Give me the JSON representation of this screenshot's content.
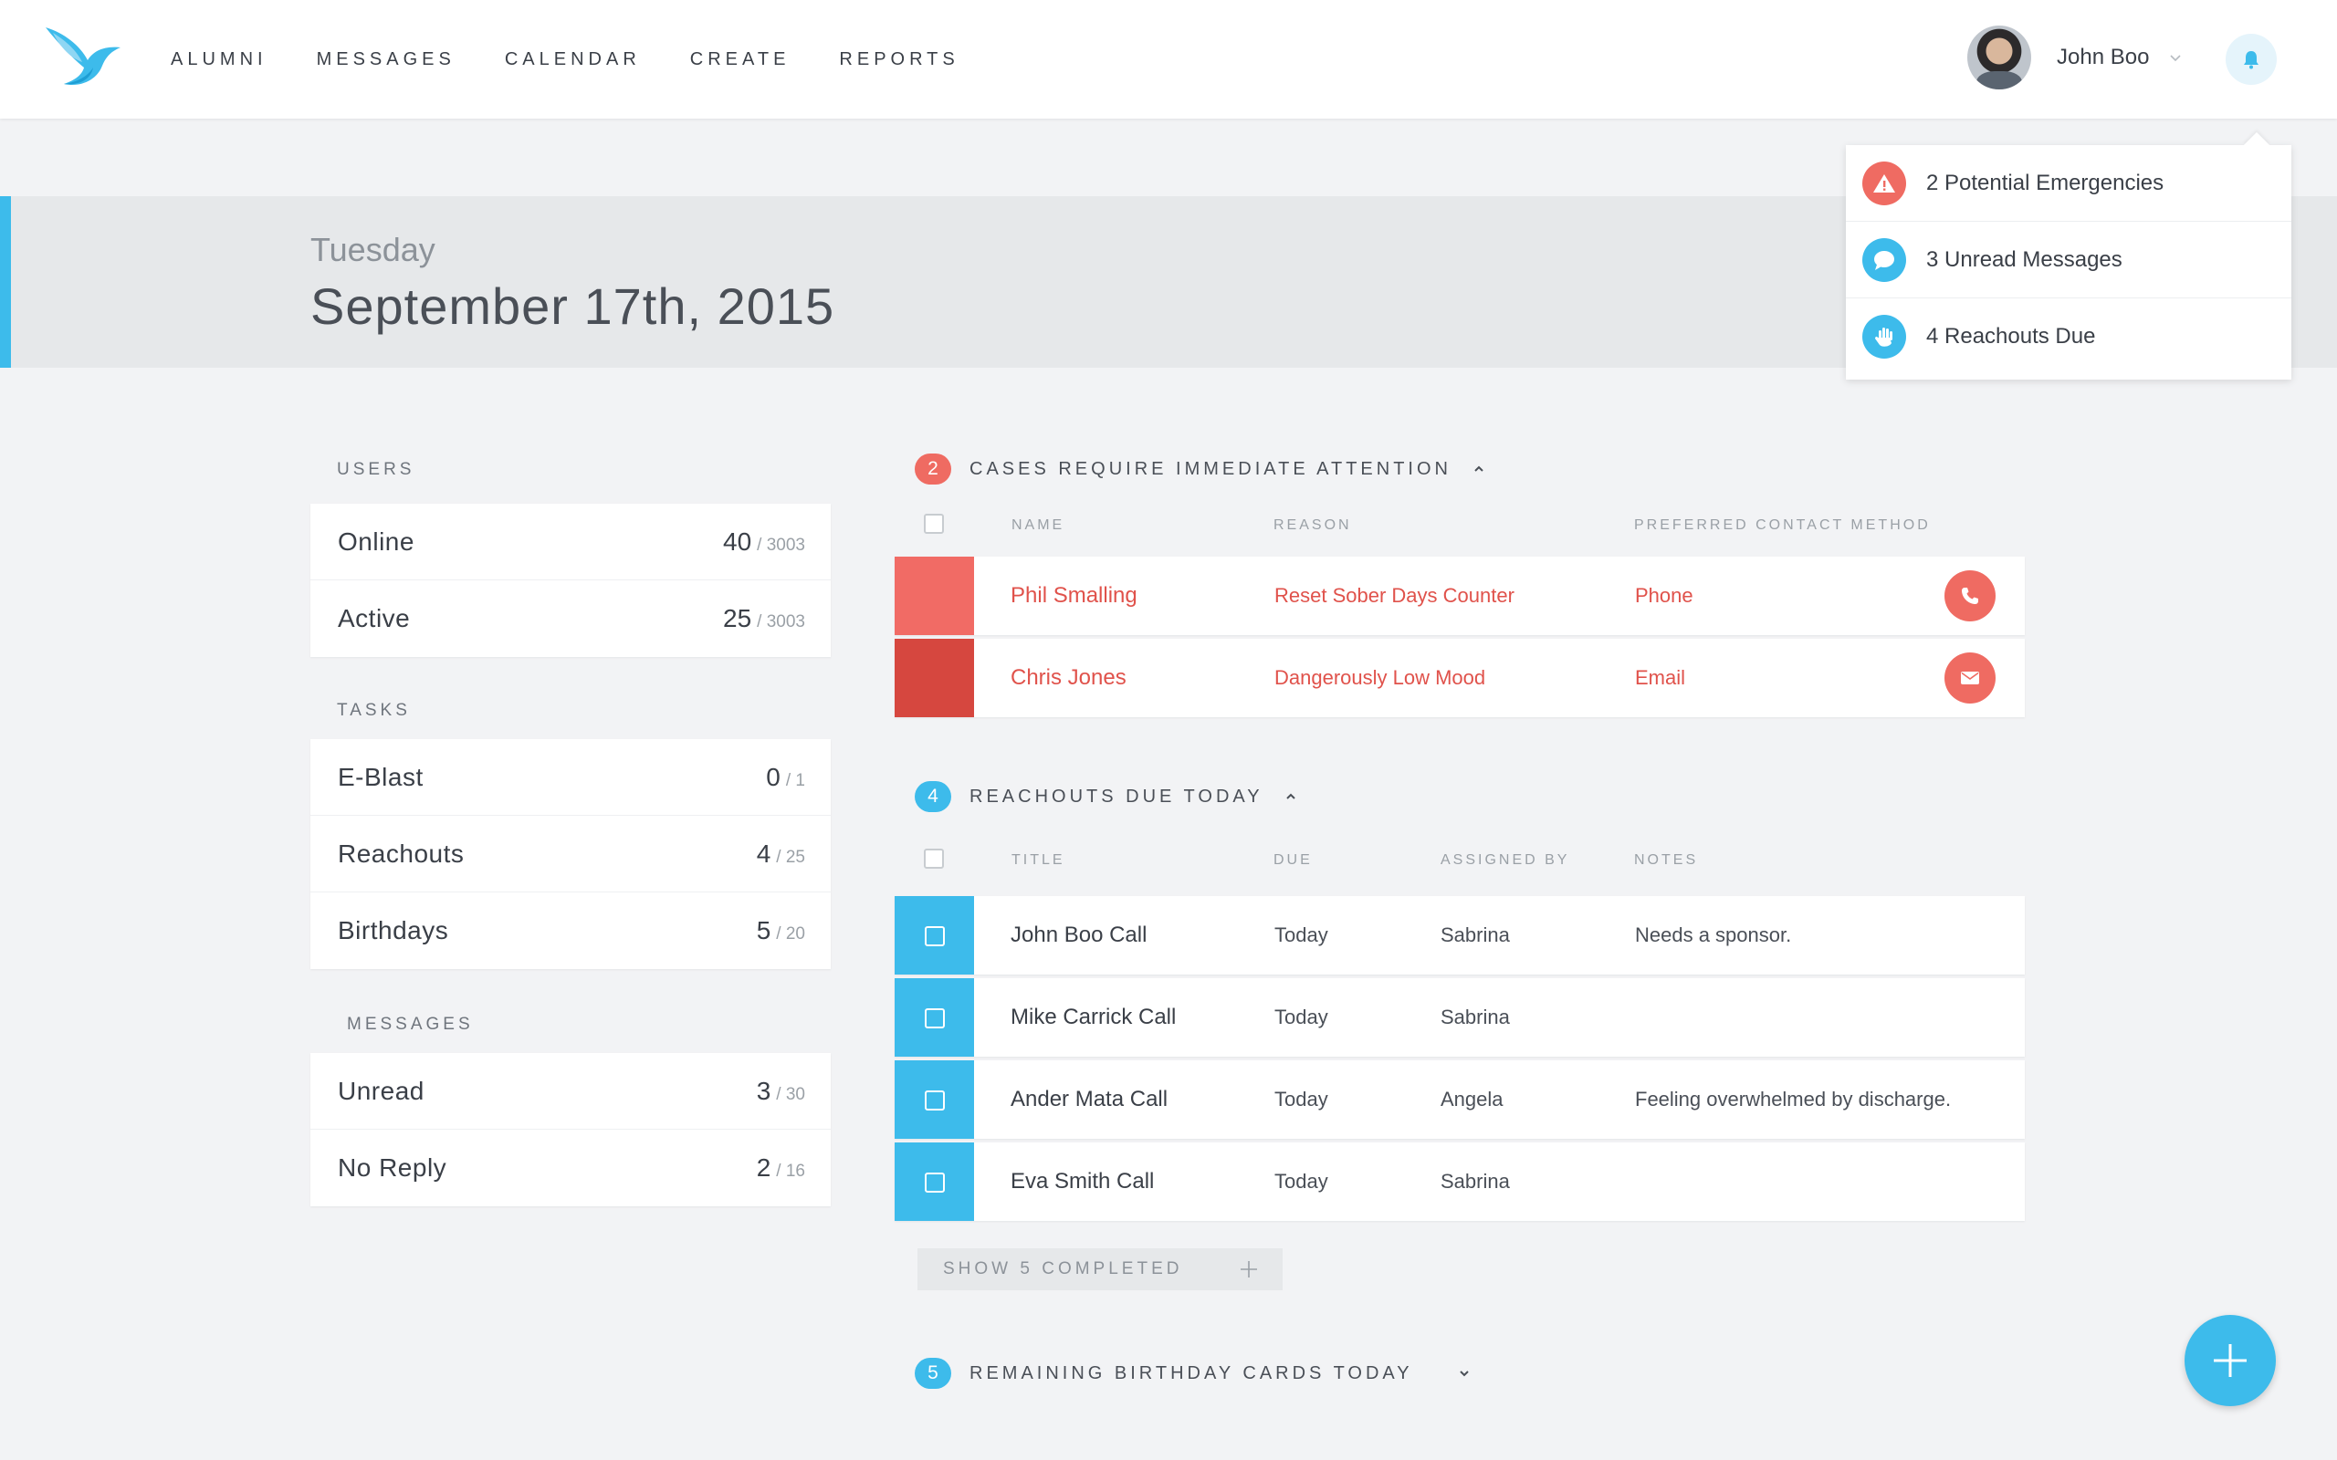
{
  "colors": {
    "accent": "#3dbbeb",
    "danger": "#ef6b62",
    "danger_dark": "#d84a43",
    "row_red_light": "#f16b65",
    "row_red_dark": "#d6473f"
  },
  "nav": {
    "items": [
      {
        "label": "ALUMNI"
      },
      {
        "label": "MESSAGES"
      },
      {
        "label": "CALENDAR"
      },
      {
        "label": "CREATE"
      },
      {
        "label": "REPORTS"
      }
    ]
  },
  "user": {
    "name": "John Boo",
    "avatar_icon": "user-avatar",
    "notifications_icon": "bell-icon"
  },
  "date_header": {
    "weekday": "Tuesday",
    "date": "September 17th, 2015"
  },
  "notifications": [
    {
      "text": "2 Potential Emergencies",
      "icon": "warning-icon",
      "color": "#ef6b62"
    },
    {
      "text": "3 Unread Messages",
      "icon": "chat-bubble-icon",
      "color": "#3dbbeb"
    },
    {
      "text": "4 Reachouts Due",
      "icon": "hand-icon",
      "color": "#3dbbeb"
    }
  ],
  "stats": {
    "users": {
      "heading": "USERS",
      "rows": [
        {
          "label": "Online",
          "value": "40",
          "total": "/ 3003"
        },
        {
          "label": "Active",
          "value": "25",
          "total": "/ 3003"
        }
      ]
    },
    "tasks": {
      "heading": "TASKS",
      "rows": [
        {
          "label": "E-Blast",
          "value": "0",
          "total": "/ 1"
        },
        {
          "label": "Reachouts",
          "value": "4",
          "total": "/ 25"
        },
        {
          "label": "Birthdays",
          "value": "5",
          "total": "/ 20"
        }
      ]
    },
    "messages": {
      "heading": "MESSAGES",
      "rows": [
        {
          "label": "Unread",
          "value": "3",
          "total": "/ 30"
        },
        {
          "label": "No Reply",
          "value": "2",
          "total": "/ 16"
        }
      ]
    }
  },
  "cases": {
    "count": "2",
    "title": "CASES REQUIRE IMMEDIATE ATTENTION",
    "columns": [
      "NAME",
      "REASON",
      "PREFERRED CONTACT METHOD"
    ],
    "rows": [
      {
        "name": "Phil Smalling",
        "reason": "Reset Sober Days Counter",
        "method": "Phone",
        "action_icon": "phone-icon"
      },
      {
        "name": "Chris Jones",
        "reason": "Dangerously Low Mood",
        "method": "Email",
        "action_icon": "mail-icon"
      }
    ]
  },
  "reachouts": {
    "count": "4",
    "title": "REACHOUTS DUE TODAY",
    "columns": [
      "TITLE",
      "DUE",
      "ASSIGNED BY",
      "NOTES"
    ],
    "rows": [
      {
        "title": "John Boo Call",
        "due": "Today",
        "assigned_by": "Sabrina",
        "notes": "Needs a sponsor."
      },
      {
        "title": "Mike Carrick Call",
        "due": "Today",
        "assigned_by": "Sabrina",
        "notes": ""
      },
      {
        "title": "Ander Mata Call",
        "due": "Today",
        "assigned_by": "Angela",
        "notes": "Feeling overwhelmed by discharge."
      },
      {
        "title": "Eva Smith Call",
        "due": "Today",
        "assigned_by": "Sabrina",
        "notes": ""
      }
    ],
    "show_completed": "SHOW 5 COMPLETED"
  },
  "birthdays": {
    "count": "5",
    "title": "REMAINING BIRTHDAY CARDS TODAY"
  }
}
